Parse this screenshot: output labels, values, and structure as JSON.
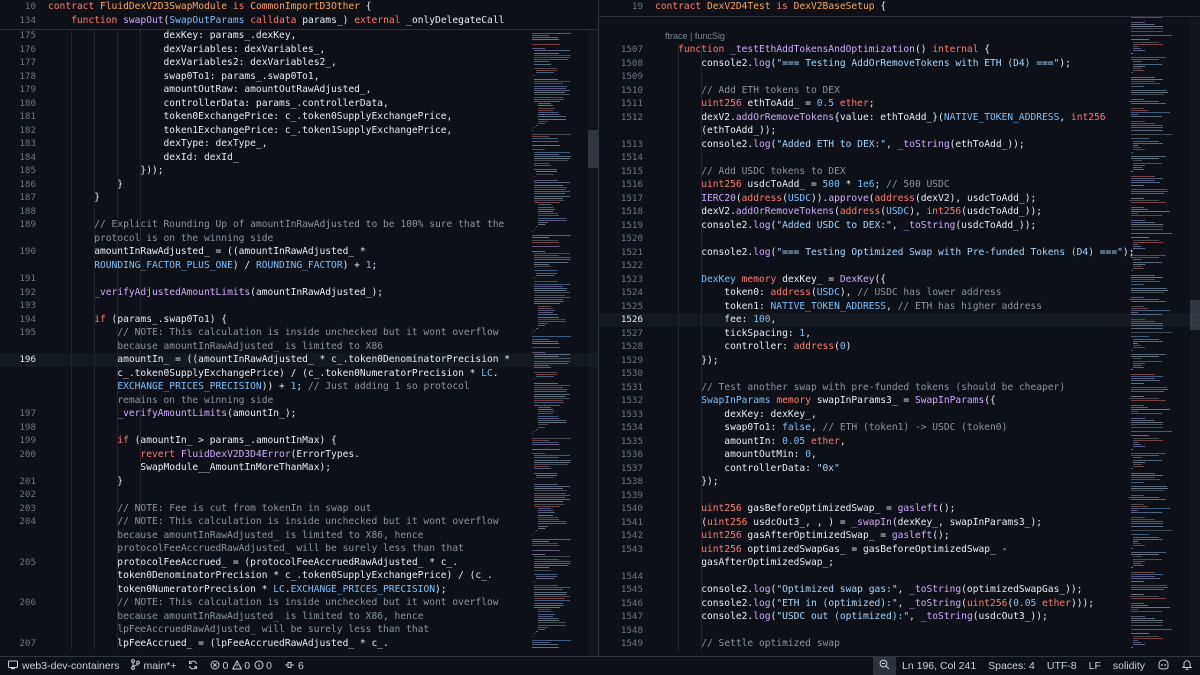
{
  "left_pane": {
    "sticky": [
      {
        "ln": "10",
        "html": "<span class='kw'>contract</span> <span class='ctr'>FluidDexV2D3SwapModule</span> <span class='kw'>is</span> <span class='ctr'>CommonImportD3Other</span> {"
      },
      {
        "ln": "134",
        "html": "    <span class='kw'>function</span> <span class='fn'>swapOut</span>(<span class='ty'>SwapOutParams</span> <span class='kw'>calldata</span> params_) <span class='kw'>external</span> _onlyDelegateCall"
      }
    ],
    "lines": [
      {
        "ln": "175",
        "html": "                    dexKey: params_.dexKey,"
      },
      {
        "ln": "176",
        "html": "                    dexVariables: dexVariables_,"
      },
      {
        "ln": "177",
        "html": "                    dexVariables2: dexVariables2_,"
      },
      {
        "ln": "178",
        "html": "                    swap0To1: params_.swap0To1,"
      },
      {
        "ln": "179",
        "html": "                    amountOutRaw: amountOutRawAdjusted_,"
      },
      {
        "ln": "180",
        "html": "                    controllerData: params_.controllerData,"
      },
      {
        "ln": "181",
        "html": "                    token0ExchangePrice: c_.token0SupplyExchangePrice,"
      },
      {
        "ln": "182",
        "html": "                    token1ExchangePrice: c_.token1SupplyExchangePrice,"
      },
      {
        "ln": "183",
        "html": "                    dexType: dexType_,"
      },
      {
        "ln": "184",
        "html": "                    dexId: dexId_"
      },
      {
        "ln": "185",
        "html": "                }));"
      },
      {
        "ln": "186",
        "html": "            }"
      },
      {
        "ln": "187",
        "html": "        }"
      },
      {
        "ln": "188",
        "html": ""
      },
      {
        "ln": "189",
        "html": "        <span class='cm'>// Explicit Rounding Up of amountInRawAdjusted to be 100% sure that the</span>"
      },
      {
        "ln": "",
        "html": "        <span class='cm'>protocol is on the winning side</span>"
      },
      {
        "ln": "190",
        "html": "        amountInRawAdjusted_ = ((amountInRawAdjusted_ *"
      },
      {
        "ln": "",
        "html": "        <span class='cn'>ROUNDING_FACTOR_PLUS_ONE</span>) / <span class='cn'>ROUNDING_FACTOR</span>) + <span class='nm'>1</span>;"
      },
      {
        "ln": "191",
        "html": ""
      },
      {
        "ln": "192",
        "html": "        <span class='fn'>_verifyAdjustedAmountLimits</span>(amountInRawAdjusted_);"
      },
      {
        "ln": "193",
        "html": ""
      },
      {
        "ln": "194",
        "html": "        <span class='kw'>if</span> (params_.swap0To1) {"
      },
      {
        "ln": "195",
        "html": "            <span class='cm'>// NOTE: This calculation is inside unchecked but it wont overflow</span>"
      },
      {
        "ln": "",
        "html": "            <span class='cm'>because amountInRawAdjusted_ is limited to X86</span>"
      },
      {
        "ln": "196",
        "html": "            amountIn_ = ((amountInRawAdjusted_ * c_.token0DenominatorPrecision *",
        "active": true
      },
      {
        "ln": "",
        "html": "            c_.token0SupplyExchangePrice) / (c_.token0NumeratorPrecision * <span class='ty'>LC</span>."
      },
      {
        "ln": "",
        "html": "            <span class='cn'>EXCHANGE_PRICES_PRECISION</span>)) + <span class='nm'>1</span>; <span class='cm'>// Just adding 1 so protocol</span>"
      },
      {
        "ln": "",
        "html": "            <span class='cm'>remains on the winning side</span>"
      },
      {
        "ln": "197",
        "html": "            <span class='fn'>_verifyAmountLimits</span>(amountIn_);"
      },
      {
        "ln": "198",
        "html": ""
      },
      {
        "ln": "199",
        "html": "            <span class='kw'>if</span> (amountIn_ &gt; params_.amountInMax) {"
      },
      {
        "ln": "200",
        "html": "                <span class='kw'>revert</span> <span class='fn'>FluidDexV2D3D4Error</span>(ErrorTypes."
      },
      {
        "ln": "",
        "html": "                SwapModule__AmountInMoreThanMax);"
      },
      {
        "ln": "201",
        "html": "            }"
      },
      {
        "ln": "202",
        "html": ""
      },
      {
        "ln": "203",
        "html": "            <span class='cm'>// NOTE: Fee is cut from tokenIn in swap out</span>"
      },
      {
        "ln": "204",
        "html": "            <span class='cm'>// NOTE: This calculation is inside unchecked but it wont overflow</span>"
      },
      {
        "ln": "",
        "html": "            <span class='cm'>because amountInRawAdjusted_ is limited to X86, hence</span>"
      },
      {
        "ln": "",
        "html": "            <span class='cm'>protocolFeeAccruedRawAdjusted_ will be surely less than that</span>"
      },
      {
        "ln": "205",
        "html": "            protocolFeeAccrued_ = (protocolFeeAccruedRawAdjusted_ * c_."
      },
      {
        "ln": "",
        "html": "            token0DenominatorPrecision * c_.token0SupplyExchangePrice) / (c_."
      },
      {
        "ln": "",
        "html": "            token0NumeratorPrecision * <span class='ty'>LC</span>.<span class='cn'>EXCHANGE_PRICES_PRECISION</span>);"
      },
      {
        "ln": "206",
        "html": "            <span class='cm'>// NOTE: This calculation is inside unchecked but it wont overflow</span>"
      },
      {
        "ln": "",
        "html": "            <span class='cm'>because amountInRawAdjusted_ is limited to X86, hence</span>"
      },
      {
        "ln": "",
        "html": "            <span class='cm'>lpFeeAccruedRawAdjusted_ will be surely less than that</span>"
      },
      {
        "ln": "207",
        "html": "            lpFeeAccrued_ = (lpFeeAccruedRawAdjusted_ * c_."
      }
    ]
  },
  "right_pane": {
    "sticky": [
      {
        "ln": "19",
        "html": "<span class='kw'>contract</span> <span class='ctr'>DexV2D4Test</span> <span class='kw'>is</span> <span class='ctr'>DexV2BaseSetup</span> {"
      }
    ],
    "codelens": "ftrace | funcSig",
    "lines": [
      {
        "ln": "1507",
        "html": "    <span class='kw'>function</span> <span class='fn'>_testEthAddTokensAndOptimization</span>() <span class='kw'>internal</span> {"
      },
      {
        "ln": "1508",
        "html": "        console2.<span class='fn'>log</span>(<span class='st'>\"=== Testing AddOrRemoveTokens with ETH (D4) ===\"</span>);"
      },
      {
        "ln": "1509",
        "html": ""
      },
      {
        "ln": "1510",
        "html": "        <span class='cm'>// Add ETH tokens to DEX</span>"
      },
      {
        "ln": "1511",
        "html": "        <span class='kw'>uint256</span> ethToAdd_ = <span class='nm'>0.5</span> <span class='kw'>ether</span>;"
      },
      {
        "ln": "1512",
        "html": "        dexV2.<span class='fn'>addOrRemoveTokens</span>{value: ethToAdd_}(<span class='cn'>NATIVE_TOKEN_ADDRESS</span>, <span class='kw'>int256</span>"
      },
      {
        "ln": "",
        "html": "        (ethToAdd_));"
      },
      {
        "ln": "1513",
        "html": "        console2.<span class='fn'>log</span>(<span class='st'>\"Added ETH to DEX:\"</span>, <span class='fn'>_toString</span>(ethToAdd_));"
      },
      {
        "ln": "1514",
        "html": ""
      },
      {
        "ln": "1515",
        "html": "        <span class='cm'>// Add USDC tokens to DEX</span>"
      },
      {
        "ln": "1516",
        "html": "        <span class='kw'>uint256</span> usdcToAdd_ = <span class='nm'>500</span> * <span class='nm'>1e6</span>; <span class='cm'>// 500 USDC</span>"
      },
      {
        "ln": "1517",
        "html": "        <span class='fn'>IERC20</span>(<span class='kw'>address</span>(<span class='cn'>USDC</span>)).<span class='fn'>approve</span>(<span class='kw'>address</span>(dexV2), usdcToAdd_);"
      },
      {
        "ln": "1518",
        "html": "        dexV2.<span class='fn'>addOrRemoveTokens</span>(<span class='kw'>address</span>(<span class='cn'>USDC</span>), <span class='kw'>int256</span>(usdcToAdd_));"
      },
      {
        "ln": "1519",
        "html": "        console2.<span class='fn'>log</span>(<span class='st'>\"Added USDC to DEX:\"</span>, <span class='fn'>_toString</span>(usdcToAdd_));"
      },
      {
        "ln": "1520",
        "html": ""
      },
      {
        "ln": "1521",
        "html": "        console2.<span class='fn'>log</span>(<span class='st'>\"=== Testing Optimized Swap with Pre-funded Tokens (D4) ===\"</span>);"
      },
      {
        "ln": "1522",
        "html": ""
      },
      {
        "ln": "1523",
        "html": "        <span class='ty'>DexKey</span> <span class='kw'>memory</span> dexKey_ = <span class='fn'>DexKey</span>({"
      },
      {
        "ln": "1524",
        "html": "            token0: <span class='kw'>address</span>(<span class='cn'>USDC</span>), <span class='cm'>// USDC has lower address</span>"
      },
      {
        "ln": "1525",
        "html": "            token1: <span class='cn'>NATIVE_TOKEN_ADDRESS</span>, <span class='cm'>// ETH has higher address</span>"
      },
      {
        "ln": "1526",
        "html": "            fee: <span class='nm'>100</span>,",
        "active": true
      },
      {
        "ln": "1527",
        "html": "            tickSpacing: <span class='nm'>1</span>,"
      },
      {
        "ln": "1528",
        "html": "            controller: <span class='kw'>address</span>(<span class='nm'>0</span>)"
      },
      {
        "ln": "1529",
        "html": "        });"
      },
      {
        "ln": "1530",
        "html": ""
      },
      {
        "ln": "1531",
        "html": "        <span class='cm'>// Test another swap with pre-funded tokens (should be cheaper)</span>"
      },
      {
        "ln": "1532",
        "html": "        <span class='ty'>SwapInParams</span> <span class='kw'>memory</span> swapInParams3_ = <span class='fn'>SwapInParams</span>({"
      },
      {
        "ln": "1533",
        "html": "            dexKey: dexKey_,"
      },
      {
        "ln": "1534",
        "html": "            swap0To1: <span class='nm'>false</span>, <span class='cm'>// ETH (token1) -&gt; USDC (token0)</span>"
      },
      {
        "ln": "1535",
        "html": "            amountIn: <span class='nm'>0.05</span> <span class='kw'>ether</span>,"
      },
      {
        "ln": "1536",
        "html": "            amountOutMin: <span class='nm'>0</span>,"
      },
      {
        "ln": "1537",
        "html": "            controllerData: <span class='st'>\"0x\"</span>"
      },
      {
        "ln": "1538",
        "html": "        });"
      },
      {
        "ln": "1539",
        "html": ""
      },
      {
        "ln": "1540",
        "html": "        <span class='kw'>uint256</span> gasBeforeOptimizedSwap_ = <span class='fn'>gasleft</span>();"
      },
      {
        "ln": "1541",
        "html": "        (<span class='kw'>uint256</span> usdcOut3_, , ) = <span class='fn'>_swapIn</span>(dexKey_, swapInParams3_);"
      },
      {
        "ln": "1542",
        "html": "        <span class='kw'>uint256</span> gasAfterOptimizedSwap_ = <span class='fn'>gasleft</span>();"
      },
      {
        "ln": "1543",
        "html": "        <span class='kw'>uint256</span> optimizedSwapGas_ = gasBeforeOptimizedSwap_ -"
      },
      {
        "ln": "",
        "html": "        gasAfterOptimizedSwap_;"
      },
      {
        "ln": "1544",
        "html": ""
      },
      {
        "ln": "1545",
        "html": "        console2.<span class='fn'>log</span>(<span class='st'>\"Optimized swap gas:\"</span>, <span class='fn'>_toString</span>(optimizedSwapGas_));"
      },
      {
        "ln": "1546",
        "html": "        console2.<span class='fn'>log</span>(<span class='st'>\"ETH in (optimized):\"</span>, <span class='fn'>_toString</span>(<span class='kw'>uint256</span>(<span class='nm'>0.05</span> <span class='kw'>ether</span>)));"
      },
      {
        "ln": "1547",
        "html": "        console2.<span class='fn'>log</span>(<span class='st'>\"USDC out (optimized):\"</span>, <span class='fn'>_toString</span>(usdcOut3_));"
      },
      {
        "ln": "1548",
        "html": ""
      },
      {
        "ln": "1549",
        "html": "        <span class='cm'>// Settle optimized swap</span>"
      }
    ]
  },
  "statusbar": {
    "remote": "web3-dev-containers",
    "branch": "main*+",
    "errors": "0",
    "warnings": "0",
    "info": "0",
    "ports": "6",
    "cursor": "Ln 196, Col 241",
    "spaces": "Spaces: 4",
    "encoding": "UTF-8",
    "eol": "LF",
    "language": "solidity"
  },
  "colors": {
    "background": "#0d1117",
    "keyword": "#ff7b72",
    "type": "#79c0ff",
    "function": "#d2a8ff",
    "string": "#a5d6ff",
    "comment": "#8b949e",
    "contract": "#ffa657"
  },
  "icons": [
    "remote-icon",
    "git-branch-icon",
    "sync-icon",
    "error-icon",
    "warning-icon",
    "info-icon",
    "ports-icon",
    "zoom-icon",
    "copilot-icon",
    "bell-icon"
  ]
}
